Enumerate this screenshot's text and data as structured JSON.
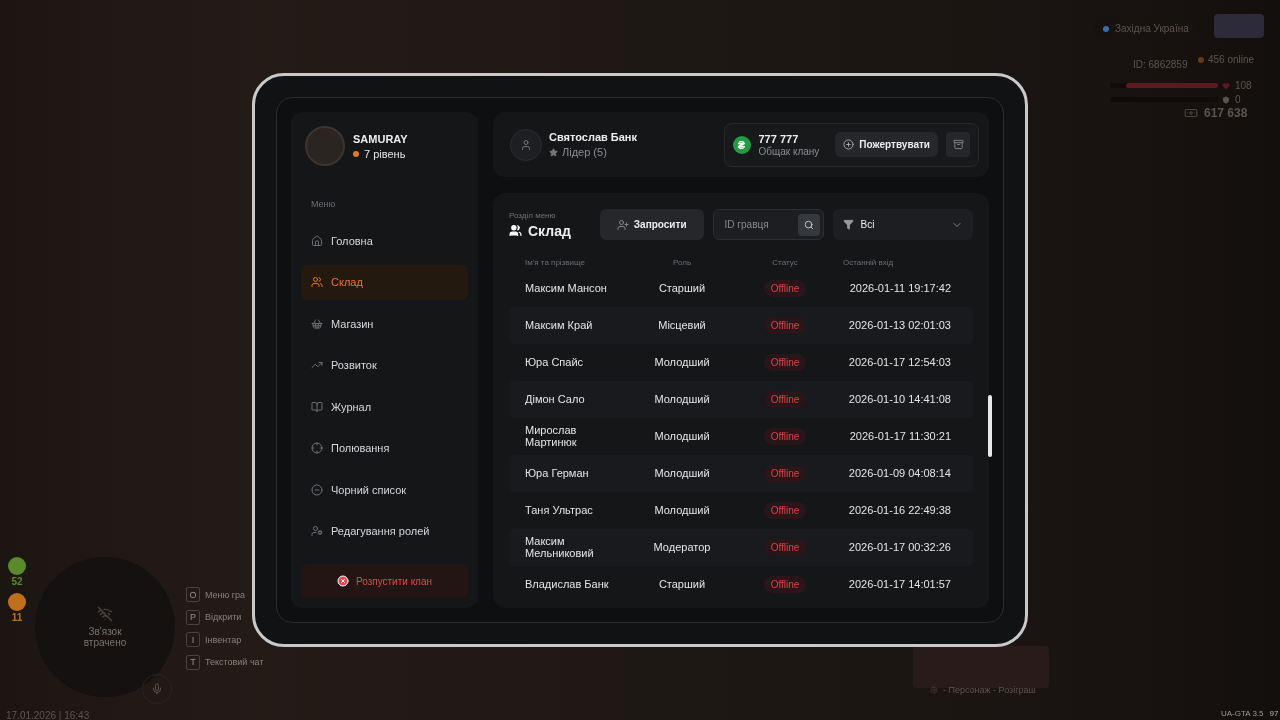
{
  "hud": {
    "server": "Західна Україна",
    "player_id": "ID: 6862859",
    "online": "456 online",
    "health": {
      "reading": "108",
      "level": 0.85
    },
    "armor": {
      "reading": "0",
      "level": 0
    },
    "money": "617 638",
    "counters": [
      {
        "value": "52",
        "color": "#5a8a2c"
      },
      {
        "value": "11",
        "color": "#c0701c"
      }
    ],
    "voice_status": "Зв'язок втрачено",
    "hotkeys": [
      {
        "key": "O",
        "label": "Меню гра"
      },
      {
        "key": "P",
        "label": "Відкрити"
      },
      {
        "key": "I",
        "label": "Інвентар"
      },
      {
        "key": "T",
        "label": "Текстовий чат"
      }
    ],
    "datetime": "17.01.2026 | 16:43",
    "giveaway_caption": "- Персонаж - Розіграш",
    "version": "UA-GTA 3.5",
    "fps": "97"
  },
  "profile": {
    "name": "SAMURAY",
    "level": "7 рівень"
  },
  "menu_label": "Меню",
  "menu": [
    {
      "label": "Головна",
      "selected": false
    },
    {
      "label": "Склад",
      "selected": true
    },
    {
      "label": "Магазин",
      "selected": false
    },
    {
      "label": "Розвиток",
      "selected": false
    },
    {
      "label": "Журнал",
      "selected": false
    },
    {
      "label": "Полювання",
      "selected": false
    },
    {
      "label": "Чорний список",
      "selected": false
    },
    {
      "label": "Редагування ролей",
      "selected": false
    }
  ],
  "dissolve_button": "Розпустити клан",
  "leader": {
    "name": "Святослав Банк",
    "role": "Лідер (5)"
  },
  "bank": {
    "currency_sign": "₴",
    "amount": "777 777",
    "label": "Общак клану",
    "donate_button": "Пожертвувати"
  },
  "section": {
    "caption": "Розділ меню",
    "title": "Склад"
  },
  "invite_button": "Запросити",
  "search": {
    "placeholder": "ID гравця"
  },
  "filter": {
    "value": "Всі"
  },
  "table": {
    "columns": [
      "Ім'я та прізвище",
      "Роль",
      "Статус",
      "Останній вхід"
    ],
    "rows": [
      {
        "name": "Максим Мансон",
        "role": "Старший",
        "status": {
          "text": "Offline",
          "kind": "offline"
        },
        "last_login": "2026-01-11 19:17:42"
      },
      {
        "name": "Максим Край",
        "role": "Місцевий",
        "status": {
          "text": "Offline",
          "kind": "offline"
        },
        "last_login": "2026-01-13 02:01:03"
      },
      {
        "name": "Юра Спайс",
        "role": "Молодший",
        "status": {
          "text": "Offline",
          "kind": "offline"
        },
        "last_login": "2026-01-17 12:54:03"
      },
      {
        "name": "Дімон Сало",
        "role": "Молодший",
        "status": {
          "text": "Offline",
          "kind": "offline"
        },
        "last_login": "2026-01-10 14:41:08"
      },
      {
        "name": "Мирослав Мартинюк",
        "role": "Молодший",
        "status": {
          "text": "Offline",
          "kind": "offline"
        },
        "last_login": "2026-01-17 11:30:21"
      },
      {
        "name": "Юра Герман",
        "role": "Молодший",
        "status": {
          "text": "Offline",
          "kind": "offline"
        },
        "last_login": "2026-01-09 04:08:14"
      },
      {
        "name": "Таня Ультрас",
        "role": "Молодший",
        "status": {
          "text": "Offline",
          "kind": "offline"
        },
        "last_login": "2026-01-16 22:49:38"
      },
      {
        "name": "Максим Мельниковий",
        "role": "Модератор",
        "status": {
          "text": "Offline",
          "kind": "offline"
        },
        "last_login": "2026-01-17 00:32:26"
      },
      {
        "name": "Владислав Банк",
        "role": "Старший",
        "status": {
          "text": "Offline",
          "kind": "offline"
        },
        "last_login": "2026-01-17 14:01:57"
      }
    ]
  }
}
